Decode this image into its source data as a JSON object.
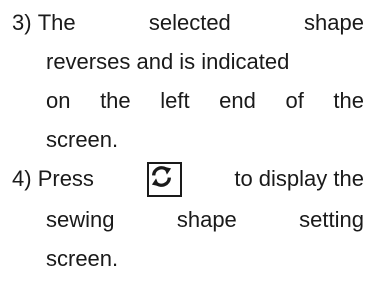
{
  "step3": {
    "number": "3)",
    "line1": [
      "The",
      "selected",
      "shape"
    ],
    "line2": "reverses and is indicated",
    "line3": [
      "on",
      "the",
      "left",
      "end",
      "of",
      "the"
    ],
    "line4": "screen."
  },
  "step4": {
    "number": "4)",
    "press": "Press",
    "after_key": "to display the",
    "line2": [
      "sewing",
      "shape",
      "setting"
    ],
    "line3": "screen.",
    "key_icon": "refresh-arrows-icon"
  }
}
